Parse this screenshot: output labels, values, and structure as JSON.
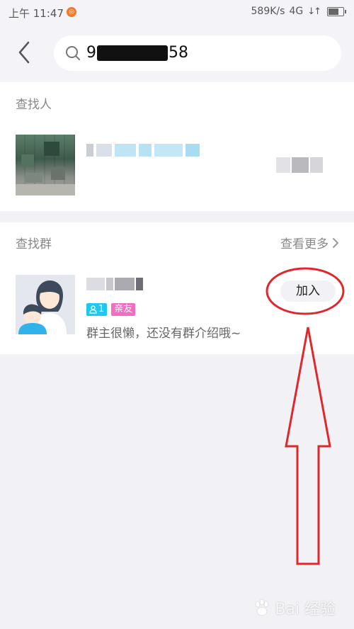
{
  "status_bar": {
    "time": "上午 11:47",
    "network_speed": "589K/s",
    "signal": "4G",
    "arrows": "↓↑",
    "battery_level": 0.7
  },
  "header": {
    "search_query_prefix": "9",
    "search_query_suffix": "58"
  },
  "people_section": {
    "title": "查找人"
  },
  "group_section": {
    "title": "查找群",
    "more_label": "查看更多",
    "member_count": "1",
    "tag": "亲友",
    "description": "群主很懒，还没有群介绍哦~",
    "join_label": "加入"
  },
  "watermark": {
    "text": "Bai 经验"
  },
  "colors": {
    "background": "#f2f2f6",
    "member_badge": "#1ec8f2",
    "tag_badge": "#f36cc2",
    "annotation": "#e0272b"
  }
}
